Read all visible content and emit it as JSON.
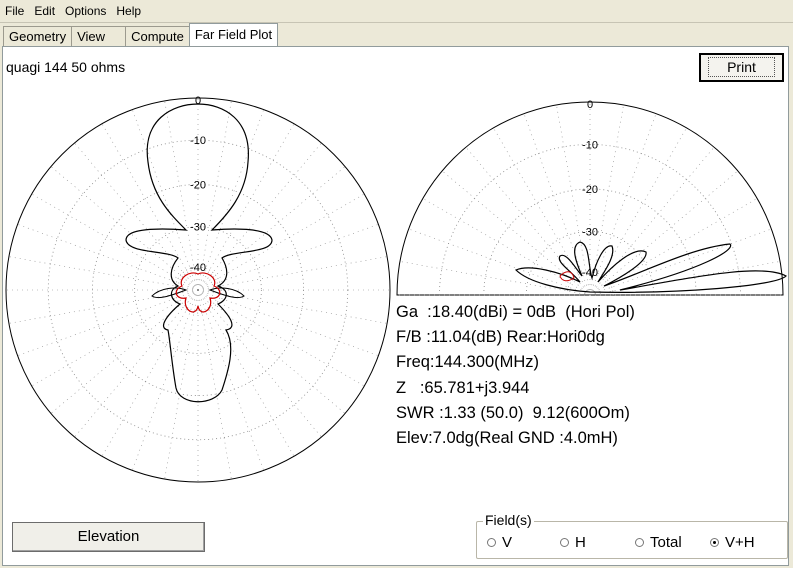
{
  "menu": [
    "File",
    "Edit",
    "Options",
    "Help"
  ],
  "tabs": [
    "Geometry",
    "View",
    "Compute",
    "Far Field Plot"
  ],
  "active_tab": "Far Field Plot",
  "antenna_title": "quagi 144 50 ohms",
  "print_label": "Print",
  "elevation_label": "Elevation",
  "ring_labels": [
    "0",
    "-10",
    "-20",
    "-30",
    "-40"
  ],
  "info": {
    "ga": "Ga  :18.40(dBi) = 0dB  (Hori Pol)",
    "fb": "F/B :11.04(dB) Rear:Hori0dg",
    "freq": "Freq:144.300(MHz)",
    "z": "Z   :65.781+j3.944",
    "swr": "SWR :1.33 (50.0)  9.12(600Om)",
    "elev": "Elev:7.0dg(Real GND :4.0mH)"
  },
  "field": {
    "label": "Field(s)",
    "options": [
      "V",
      "H",
      "Total",
      "V+H"
    ],
    "selected": "V+H"
  },
  "colors": {
    "pattern": "#000000",
    "secondary_pattern": "#cc0000",
    "grid": "#888888"
  }
}
